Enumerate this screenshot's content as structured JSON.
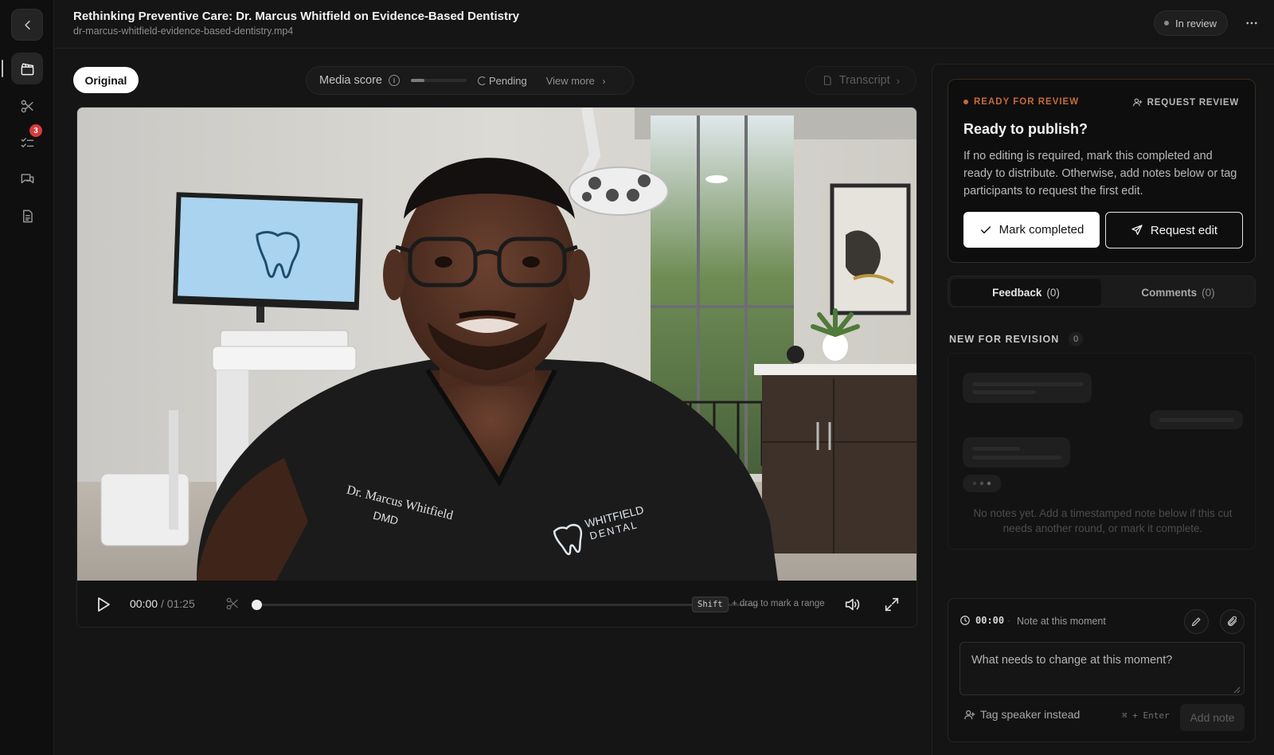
{
  "header": {
    "title": "Rethinking Preventive Care: Dr. Marcus Whitfield on Evidence-Based Dentistry",
    "filename": "dr-marcus-whitfield-evidence-based-dentistry.mp4",
    "status": "In review",
    "more_icon": "more-horizontal-icon"
  },
  "rail": {
    "badge_count": "3",
    "icons": [
      "chevron-left-icon",
      "clapperboard-icon",
      "scissors-icon",
      "checklist-icon",
      "chat-icon",
      "document-icon"
    ]
  },
  "toolbar": {
    "original_label": "Original",
    "media_score_label": "Media score",
    "media_score_progress": 0.25,
    "pending_label": "Pending",
    "view_more_label": "View more",
    "transcript_label": "Transcript"
  },
  "video": {
    "current_time": "00:00",
    "duration": "/ 01:25",
    "playhead_fraction": 0,
    "shift_key": "Shift",
    "range_hint": "+ drag to mark a range",
    "scrub_label": "Dr. Marcus Whitfield",
    "scrub_sublabel": "DMD",
    "logo_line1": "WHITFIELD",
    "logo_line2": "DENTAL"
  },
  "review": {
    "tag": "READY FOR REVIEW",
    "request_review": "REQUEST REVIEW",
    "title": "Ready to publish?",
    "body": "If no editing is required, mark this completed and ready to distribute. Otherwise, add notes below or tag participants to request the first edit.",
    "mark_completed": "Mark completed",
    "request_edit": "Request edit"
  },
  "tabs": {
    "feedback_label": "Feedback",
    "feedback_count": "(0)",
    "comments_label": "Comments",
    "comments_count": "(0)"
  },
  "revision": {
    "heading": "NEW FOR REVISION",
    "count": "0",
    "empty_text": "No notes yet. Add a timestamped note below if this cut needs another round, or mark it complete."
  },
  "composer": {
    "timestamp": "00:00",
    "separator": "·",
    "note_label": "Note at this moment",
    "placeholder": "What needs to change at this moment?",
    "tag_speaker": "Tag speaker instead",
    "shortcut": "⌘ + Enter",
    "add_note": "Add note"
  },
  "colors": {
    "accent_orange": "#c8693c",
    "badge_red": "#d93b3b",
    "background": "#151515"
  }
}
